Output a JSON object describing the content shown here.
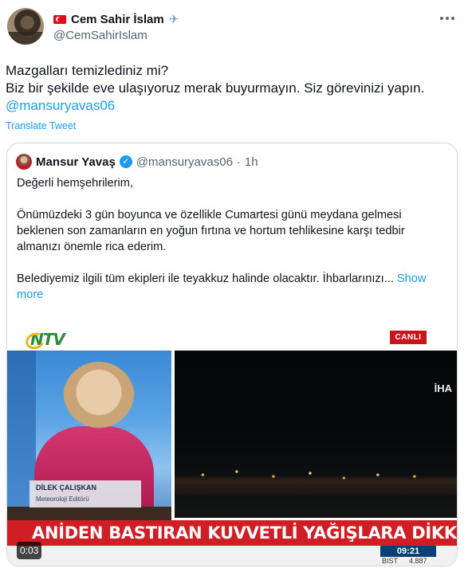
{
  "author": {
    "display_name": "Cem Sahir İslam",
    "handle": "@CemSahirIslam",
    "flag_icon": "turkey-flag-icon",
    "badge_icon": "airplane-icon"
  },
  "tweet": {
    "lines": [
      "Mazgalları temizlediniz mi?",
      "Biz bir şekilde eve ulaşıyoruz merak buyurmayın. Siz görevinizi yapın."
    ],
    "mention": "@mansuryavas06",
    "translate_label": "Translate Tweet"
  },
  "quote": {
    "name": "Mansur Yavaş",
    "handle": "@mansuryavas06",
    "separator": "·",
    "time": "1h",
    "greeting": "Değerli hemşehrilerim,",
    "para1": [
      "Önümüzdeki 3 gün boyunca ve özellikle Cumartesi günü meydana gelmesi",
      "beklenen son zamanların en yoğun fırtına ve hortum tehlikesine karşı tedbir",
      "almanızı önemle rica ederim."
    ],
    "para2": "Belediyemiz ilgili tüm ekipleri ile teyakkuz halinde olacaktır. İhbarlarınızı...",
    "show_more_a": " Show",
    "show_more_b": "more"
  },
  "video": {
    "channel_logo": "NTV",
    "live_badge": "CANLI",
    "source_logo": "İHA",
    "presenter_name": "DİLEK ÇALIŞKAN",
    "presenter_role": "Meteoroloji Editörü",
    "headline": "ANİDEN BASTIRAN KUVVETLİ YAĞIŞLARA DİKKAT",
    "clock": "09:21",
    "ticker_label": "BIST",
    "ticker_value": "4.887",
    "duration": "0:03"
  }
}
